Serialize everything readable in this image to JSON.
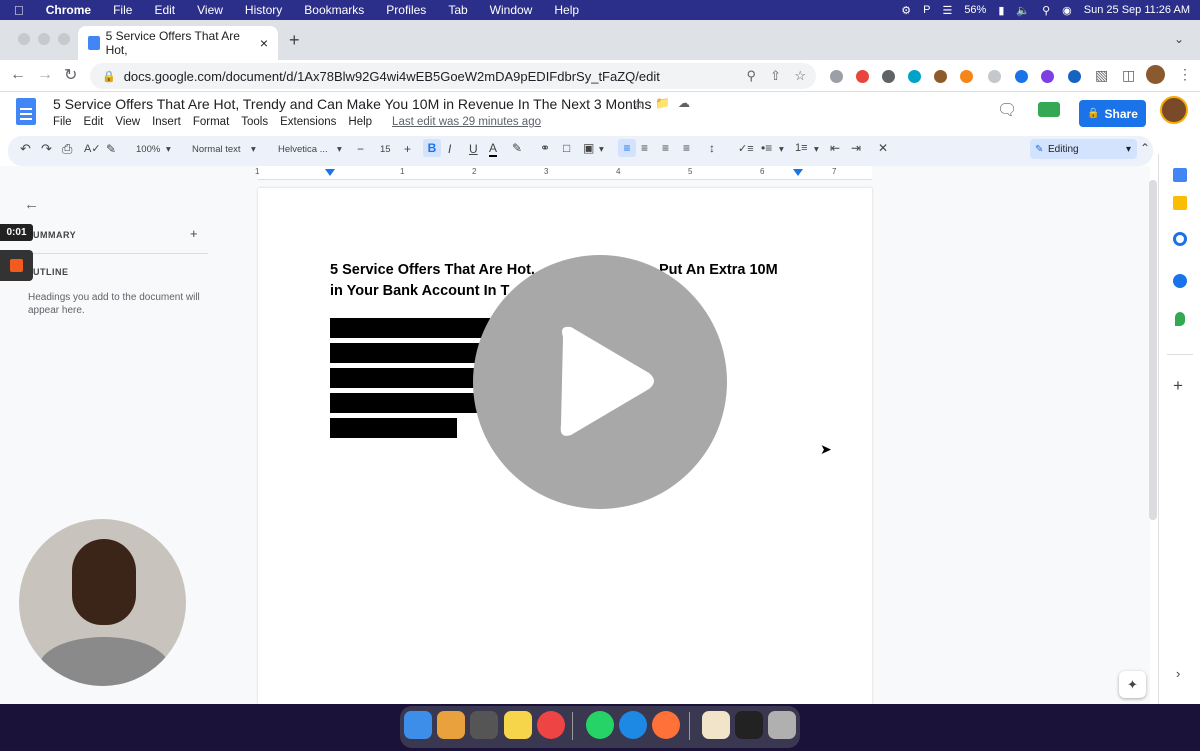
{
  "menubar": {
    "app": "Chrome",
    "items": [
      "File",
      "Edit",
      "View",
      "History",
      "Bookmarks",
      "Profiles",
      "Tab",
      "Window",
      "Help"
    ],
    "battery": "56%",
    "datetime": "Sun 25 Sep  11:26 AM"
  },
  "browser": {
    "tab_title": "5 Service Offers That Are Hot,",
    "url": "docs.google.com/document/d/1Ax78Blw92G4wi4wEB5GoeW2mDA9pEDIFdbrSy_tFaZQ/edit"
  },
  "docs": {
    "title": "5 Service Offers That Are Hot, Trendy and Can Make You 10M in Revenue In The Next 3 Months",
    "menu": [
      "File",
      "Edit",
      "View",
      "Insert",
      "Format",
      "Tools",
      "Extensions",
      "Help"
    ],
    "last_edit": "Last edit was 29 minutes ago",
    "share_label": "Share",
    "toolbar": {
      "zoom": "100%",
      "style": "Normal text",
      "font": "Helvetica ...",
      "font_size": "15",
      "mode": "Editing"
    },
    "ruler_numbers": [
      "1",
      "1",
      "2",
      "3",
      "4",
      "5",
      "6",
      "7"
    ],
    "sidebar": {
      "summary_label": "UMMARY",
      "outline_label": "UTLINE",
      "outline_hint": "Headings you add to the document will appear here."
    },
    "body": {
      "heading": "5 Service Offers That Are Hot, Trendy and Can Put An Extra 10M in Your Bank Account In The Next 3 Months",
      "heading_visible_line1a": "5 Service Offers That Are Hot,",
      "heading_visible_line1b": "Put An Extra 10M",
      "heading_visible_line2": "in Your Bank Account In T"
    }
  },
  "recording": {
    "timer": "0:01"
  },
  "colors": {
    "menubar": "#2b2f8a",
    "share": "#1a73e8",
    "toolbar": "#edf2fa",
    "play_overlay": "#a8a8a8"
  }
}
